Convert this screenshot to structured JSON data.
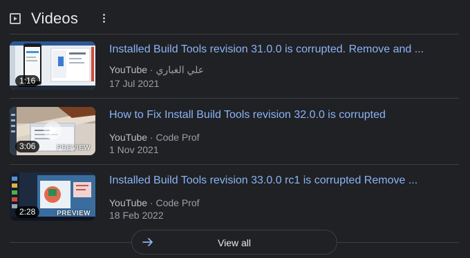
{
  "header": {
    "title": "Videos",
    "icon": "play-box-icon",
    "menu_icon": "more-vert-icon"
  },
  "videos": [
    {
      "title": "Installed Build Tools revision 31.0.0 is corrupted. Remove and ...",
      "platform": "YouTube",
      "separator": "·",
      "channel": "علي الغباري",
      "date": "17 Jul 2021",
      "duration": "1:16",
      "preview": ""
    },
    {
      "title": "How to Fix Install Build Tools revision 32.0.0 is corrupted",
      "platform": "YouTube",
      "separator": "·",
      "channel": "Code Prof",
      "date": "1 Nov 2021",
      "duration": "3:06",
      "preview": "PREVIEW"
    },
    {
      "title": "Installed Build Tools revision 33.0.0 rc1 is corrupted Remove ...",
      "platform": "YouTube",
      "separator": "·",
      "channel": "Code Prof",
      "date": "18 Feb 2022",
      "duration": "2:28",
      "preview": "PREVIEW"
    }
  ],
  "footer": {
    "view_all_label": "View all",
    "arrow_icon": "arrow-right-icon"
  },
  "colors": {
    "background": "#202124",
    "link": "#8ab4f8",
    "text": "#e8eaed",
    "muted": "#9aa0a6",
    "divider": "#3c4043"
  }
}
